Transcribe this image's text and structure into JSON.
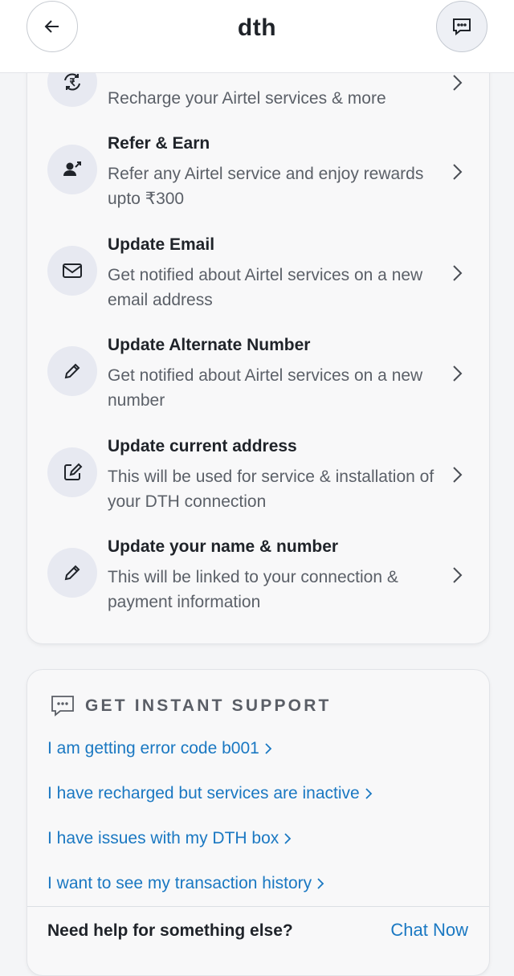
{
  "header": {
    "title": "dth",
    "back_icon": "arrow-left-icon",
    "chat_icon": "chat-bubble-icon"
  },
  "menu": {
    "items": [
      {
        "title": "",
        "subtitle": "Recharge your Airtel services & more",
        "icon": "rupee-refresh-icon"
      },
      {
        "title": "Refer & Earn",
        "subtitle": "Refer any Airtel service and enjoy rewards upto ₹300",
        "icon": "refer-user-icon"
      },
      {
        "title": "Update Email",
        "subtitle": "Get notified about Airtel services on a new email address",
        "icon": "mail-icon"
      },
      {
        "title": "Update Alternate Number",
        "subtitle": "Get notified about Airtel services on a new number",
        "icon": "pencil-icon"
      },
      {
        "title": "Update current address",
        "subtitle": "This will be used for service & installation of your DTH connection",
        "icon": "edit-square-icon"
      },
      {
        "title": "Update your name & number",
        "subtitle": "This will be linked to your connection & payment information",
        "icon": "pencil-icon"
      }
    ]
  },
  "support": {
    "title": "GET INSTANT SUPPORT",
    "icon": "chat-bubble-icon",
    "links": [
      "I am getting error code b001",
      "I have recharged but services are inactive",
      "I have issues with my DTH box",
      "I want to see my transaction history"
    ],
    "help_text": "Need help for something else?",
    "chat_now": "Chat Now"
  },
  "colors": {
    "link": "#1a78c2",
    "icon_bg": "#e7e9f1",
    "text_primary": "#1f2329",
    "text_secondary": "#5b6068"
  }
}
